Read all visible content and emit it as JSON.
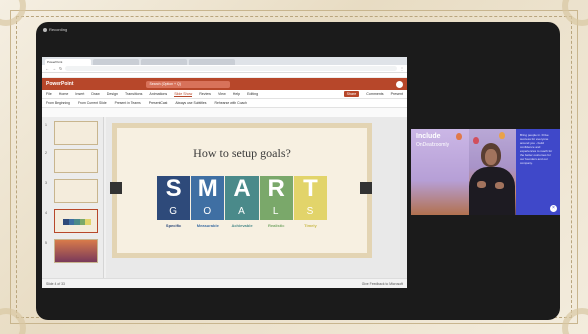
{
  "meeting": {
    "recording_label": "Recording"
  },
  "browser": {
    "tabs": [
      "PowerPoint",
      "",
      "",
      ""
    ],
    "url": "",
    "downloads": [
      "",
      "",
      "",
      "",
      "",
      "",
      ""
    ]
  },
  "powerpoint": {
    "app_name": "PowerPoint",
    "file_name": "",
    "search_placeholder": "Search (Option + Q)",
    "menu": [
      "File",
      "Home",
      "Insert",
      "Draw",
      "Design",
      "Transitions",
      "Animations",
      "Slide Show",
      "Review",
      "View",
      "Help"
    ],
    "menu_selected": "Slide Show",
    "editing_label": "Editing",
    "share_label": "Share",
    "comments_label": "Comments",
    "present_label": "Present",
    "ribbon": [
      "From Beginning",
      "From Current Slide",
      "Present in Teams",
      "PresentCast",
      "Always use Subtitles",
      "Rehearse with Coach"
    ],
    "status_left": "Slide 4 of 33",
    "status_right": "Give Feedback to Microsoft"
  },
  "slide": {
    "title": "How to setup goals?",
    "smart": [
      {
        "letter": "S",
        "word": "Specific",
        "color": "#2e4a7a"
      },
      {
        "letter": "M",
        "word": "Measurable",
        "color": "#3f6fa3"
      },
      {
        "letter": "A",
        "word": "Achievable",
        "color": "#4a8a8a"
      },
      {
        "letter": "R",
        "word": "Realistic",
        "color": "#7aa86a"
      },
      {
        "letter": "T",
        "word": "Timely",
        "color": "#e2d46a"
      }
    ],
    "goals": "GOALS"
  },
  "thumbnails": [
    {
      "num": "1"
    },
    {
      "num": "2"
    },
    {
      "num": "3"
    },
    {
      "num": "4"
    },
    {
      "num": "5"
    }
  ],
  "video": {
    "headline": "Include",
    "subline": "OnDeafzoomly",
    "right_text": "Bring people in. Drive success for everyone around you - build confidence and experiences to reach for the better outcomes for our founders and our company.",
    "name_tag": ""
  }
}
